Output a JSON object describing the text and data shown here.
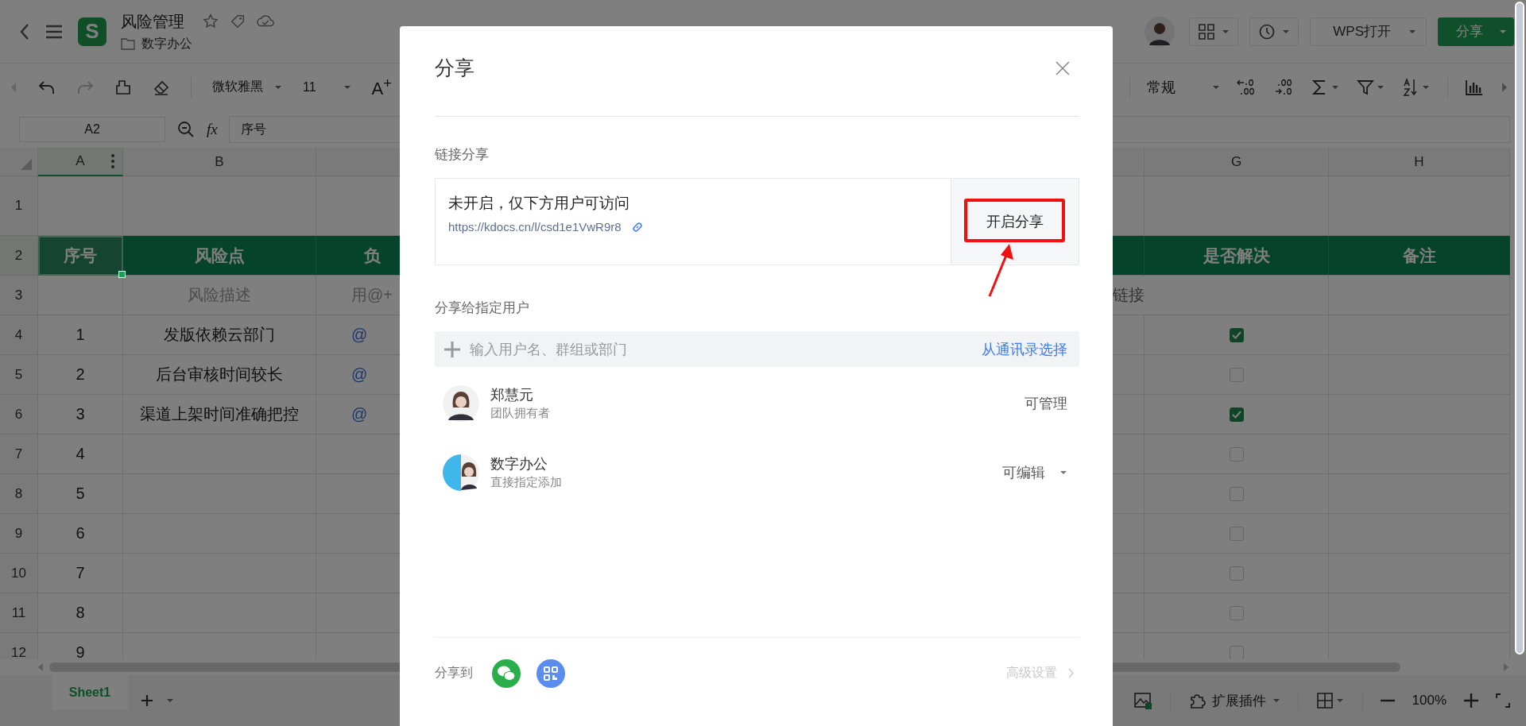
{
  "app": {
    "logo": "S",
    "title": "风险管理",
    "folder": "数字办公",
    "open_button": "WPS打开",
    "share_button": "分享"
  },
  "toolbar": {
    "font": "微软雅黑",
    "size": "11",
    "grow": "A$^{+}$",
    "number_format": "常规"
  },
  "formula_bar": {
    "cell": "A2",
    "fx": "fx",
    "value": "序号"
  },
  "columns": [
    "A",
    "B",
    "G",
    "H"
  ],
  "rows": [
    {
      "number": "1",
      "kind": "blank",
      "cells": {}
    },
    {
      "number": "2",
      "kind": "header",
      "cells": {
        "a": "序号",
        "b": "风险点",
        "c": "负",
        "g": "是否解决",
        "h": "备注"
      }
    },
    {
      "number": "3",
      "kind": "hint",
      "cells": {
        "b": "风险描述",
        "c": "用@+",
        "f": "链接"
      }
    },
    {
      "number": "4",
      "kind": "data",
      "cells": {
        "a": "1",
        "b": "发版依赖云部门",
        "c": "@"
      },
      "checked": true
    },
    {
      "number": "5",
      "kind": "data",
      "cells": {
        "a": "2",
        "b": "后台审核时间较长",
        "c": "@"
      },
      "checked": false
    },
    {
      "number": "6",
      "kind": "data",
      "cells": {
        "a": "3",
        "b": "渠道上架时间准确把控",
        "c": "@"
      },
      "checked": true
    },
    {
      "number": "7",
      "kind": "data",
      "cells": {
        "a": "4"
      },
      "checked": false
    },
    {
      "number": "8",
      "kind": "data",
      "cells": {
        "a": "5"
      },
      "checked": false
    },
    {
      "number": "9",
      "kind": "data",
      "cells": {
        "a": "6"
      },
      "checked": false
    },
    {
      "number": "10",
      "kind": "data",
      "cells": {
        "a": "7"
      },
      "checked": false
    },
    {
      "number": "11",
      "kind": "data",
      "cells": {
        "a": "8"
      },
      "checked": false
    },
    {
      "number": "12",
      "kind": "data",
      "cells": {
        "a": "9"
      },
      "checked": false
    }
  ],
  "sheet_tabs": [
    {
      "label": "Sheet1",
      "selected": true
    }
  ],
  "status_bar": {
    "plugins": "扩展插件",
    "zoom": "100%"
  },
  "dialog": {
    "title": "分享",
    "link_section": "链接分享",
    "link_status": "未开启，仅下方用户可访问",
    "link_url": "https://kdocs.cn/l/csd1e1VwR9r8",
    "enable_button": "开启分享",
    "users_section": "分享给指定用户",
    "invite_placeholder": "输入用户名、群组或部门",
    "contacts_link": "从通讯录选择",
    "members": [
      {
        "kind": "person",
        "name": "郑慧元",
        "role": "团队拥有者",
        "permission": "可管理",
        "dropdown": false
      },
      {
        "kind": "group",
        "name": "数字办公",
        "role": "直接指定添加",
        "permission": "可编辑",
        "dropdown": true
      }
    ],
    "share_to": "分享到",
    "advanced": "高级设置"
  }
}
